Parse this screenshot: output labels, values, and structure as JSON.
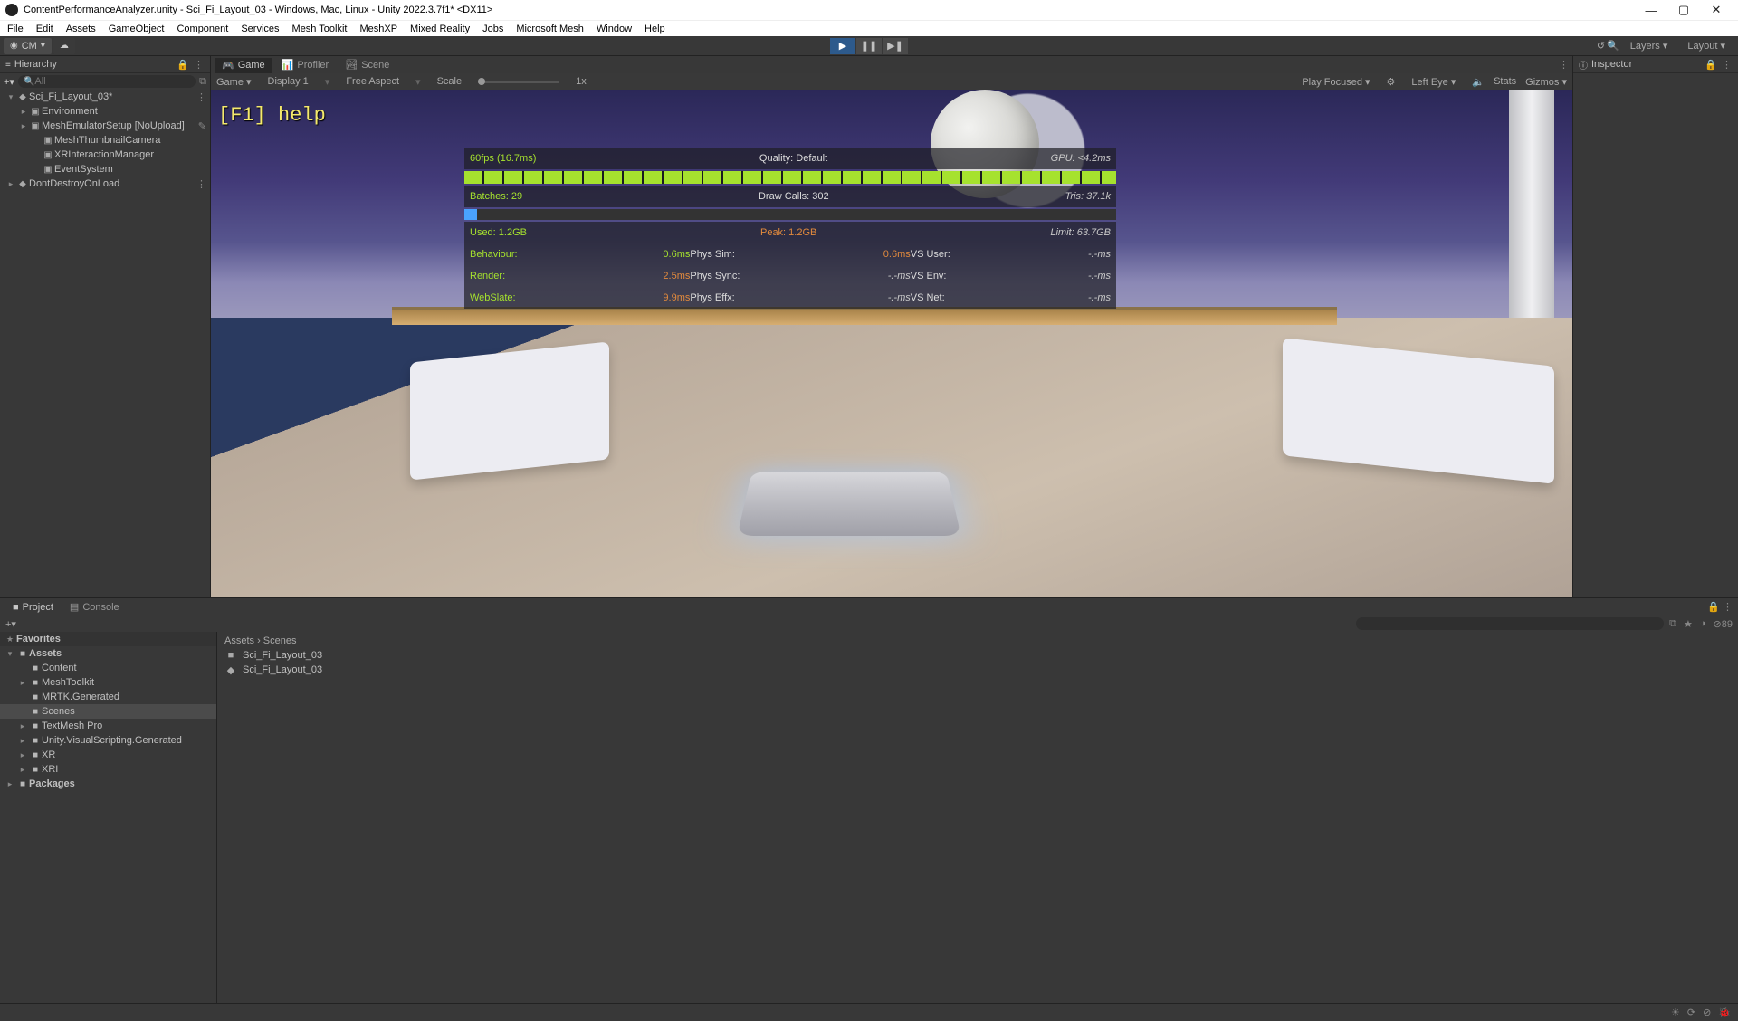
{
  "title": "ContentPerformanceAnalyzer.unity - Sci_Fi_Layout_03 - Windows, Mac, Linux - Unity 2022.3.7f1* <DX11>",
  "menu": [
    "File",
    "Edit",
    "Assets",
    "GameObject",
    "Component",
    "Services",
    "Mesh Toolkit",
    "MeshXP",
    "Mixed Reality",
    "Jobs",
    "Microsoft Mesh",
    "Window",
    "Help"
  ],
  "toolbar": {
    "account": "CM",
    "layers": "Layers",
    "layout": "Layout"
  },
  "hierarchy": {
    "title": "Hierarchy",
    "search_placeholder": "All",
    "items": [
      {
        "indent": 0,
        "arrow": "▾",
        "icon": "◆",
        "label": "Sci_Fi_Layout_03*",
        "trail": "⋮"
      },
      {
        "indent": 1,
        "arrow": "▸",
        "icon": "▣",
        "label": "Environment"
      },
      {
        "indent": 1,
        "arrow": "▸",
        "icon": "▣",
        "label": "MeshEmulatorSetup [NoUpload]",
        "trail": "✎"
      },
      {
        "indent": 2,
        "arrow": "",
        "icon": "▣",
        "label": "MeshThumbnailCamera"
      },
      {
        "indent": 2,
        "arrow": "",
        "icon": "▣",
        "label": "XRInteractionManager"
      },
      {
        "indent": 2,
        "arrow": "",
        "icon": "▣",
        "label": "EventSystem"
      },
      {
        "indent": 0,
        "arrow": "▸",
        "icon": "◆",
        "label": "DontDestroyOnLoad",
        "trail": "⋮"
      }
    ]
  },
  "tabs": {
    "game": "Game",
    "profiler": "Profiler",
    "scene": "Scene"
  },
  "viewbar": {
    "mode": "Game",
    "display": "Display 1",
    "aspect": "Free Aspect",
    "scale_label": "Scale",
    "scale_val": "1x",
    "play_focused": "Play Focused",
    "eye": "Left Eye",
    "stats": "Stats",
    "gizmos": "Gizmos"
  },
  "hud": {
    "help": "[F1] help",
    "fps": "60fps (16.7ms)",
    "quality": "Quality: Default",
    "gpu": "GPU: <4.2ms",
    "batches": "Batches: 29",
    "draws": "Draw Calls: 302",
    "tris": "Tris: 37.1k",
    "used": "Used: 1.2GB",
    "peak": "Peak: 1.2GB",
    "limit": "Limit: 63.7GB",
    "l1": {
      "a": "Behaviour:",
      "av": "0.6ms",
      "b": "Phys Sim:",
      "bv": "0.6ms",
      "c": "VS User:",
      "cv": "-.-ms"
    },
    "l2": {
      "a": "Render:",
      "av": "2.5ms",
      "b": "Phys Sync:",
      "bv": "-.-ms",
      "c": "VS Env:",
      "cv": "-.-ms"
    },
    "l3": {
      "a": "WebSlate:",
      "av": "9.9ms",
      "b": "Phys Effx:",
      "bv": "-.-ms",
      "c": "VS Net:",
      "cv": "-.-ms"
    }
  },
  "inspector": {
    "title": "Inspector"
  },
  "project": {
    "tab_project": "Project",
    "tab_console": "Console",
    "favorites": "Favorites",
    "tree": [
      {
        "indent": 0,
        "arrow": "▾",
        "icon": "■",
        "label": "Assets",
        "sel": false,
        "bold": true
      },
      {
        "indent": 1,
        "arrow": "",
        "icon": "■",
        "label": "Content"
      },
      {
        "indent": 1,
        "arrow": "▸",
        "icon": "■",
        "label": "MeshToolkit"
      },
      {
        "indent": 1,
        "arrow": "",
        "icon": "■",
        "label": "MRTK.Generated"
      },
      {
        "indent": 1,
        "arrow": "",
        "icon": "■",
        "label": "Scenes",
        "sel": true
      },
      {
        "indent": 1,
        "arrow": "▸",
        "icon": "■",
        "label": "TextMesh Pro"
      },
      {
        "indent": 1,
        "arrow": "▸",
        "icon": "■",
        "label": "Unity.VisualScripting.Generated"
      },
      {
        "indent": 1,
        "arrow": "▸",
        "icon": "■",
        "label": "XR"
      },
      {
        "indent": 1,
        "arrow": "▸",
        "icon": "■",
        "label": "XRI"
      },
      {
        "indent": 0,
        "arrow": "▸",
        "icon": "■",
        "label": "Packages",
        "bold": true
      }
    ],
    "breadcrumb": "Assets  ›  Scenes",
    "items": [
      {
        "icon": "■",
        "label": "Sci_Fi_Layout_03"
      },
      {
        "icon": "◆",
        "label": "Sci_Fi_Layout_03"
      }
    ],
    "count89": "89"
  }
}
